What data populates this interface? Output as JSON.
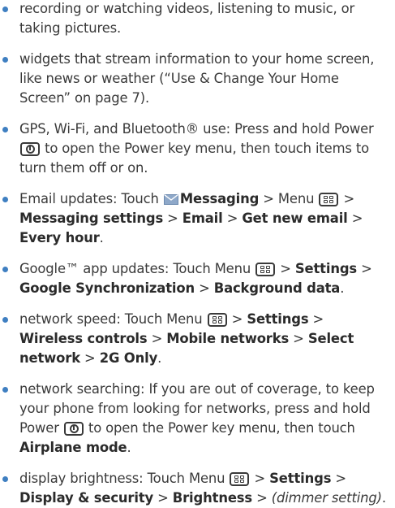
{
  "items": [
    {
      "t": "recording or watching videos, listening to music, or taking pictures."
    },
    {
      "t": "widgets that stream information to your home screen, like news or weather (“Use & Change Your Home Screen” on page 7)."
    },
    {
      "pre": "GPS, Wi-Fi, and Bluetooth® use: Press and hold Power",
      "post": "to open the Power key menu, then touch items to turn them off or on."
    },
    {
      "pre": "Email updates: Touch",
      "messaging": "Messaging",
      "menu_pre": "> Menu",
      "s1": "Messaging settings",
      "s2": "Email",
      "s3": "Get new email",
      "s4": "Every hour",
      "end": "."
    },
    {
      "pre": "Google™ app updates: Touch Menu",
      "s1": "Settings",
      "s2": "Google Synchronization",
      "s3": "Background data",
      "end": "."
    },
    {
      "pre": "network speed: Touch Menu",
      "s1": "Settings",
      "s2": "Wireless controls",
      "s3": "Mobile networks",
      "s4": "Select network",
      "s5": "2G Only",
      "end": "."
    },
    {
      "pre": "network searching: If you are out of coverage, to keep your phone from looking for networks, press and hold Power",
      "post": "to open the Power key menu, then touch",
      "s1": "Airplane mode",
      "end": "."
    },
    {
      "pre": "display brightness: Touch Menu",
      "s1": "Settings",
      "s2": "Display & security",
      "s3": "Brightness",
      "s4": "(dimmer setting)",
      "end": "."
    }
  ],
  "sep": ">",
  "icons": {
    "menu": "menu-key-icon",
    "power": "power-key-icon",
    "messaging": "envelope-icon"
  },
  "colors": {
    "bullet": "#3f7fc1",
    "text": "#3a3a3a",
    "envelope": "#8ea8c9"
  }
}
